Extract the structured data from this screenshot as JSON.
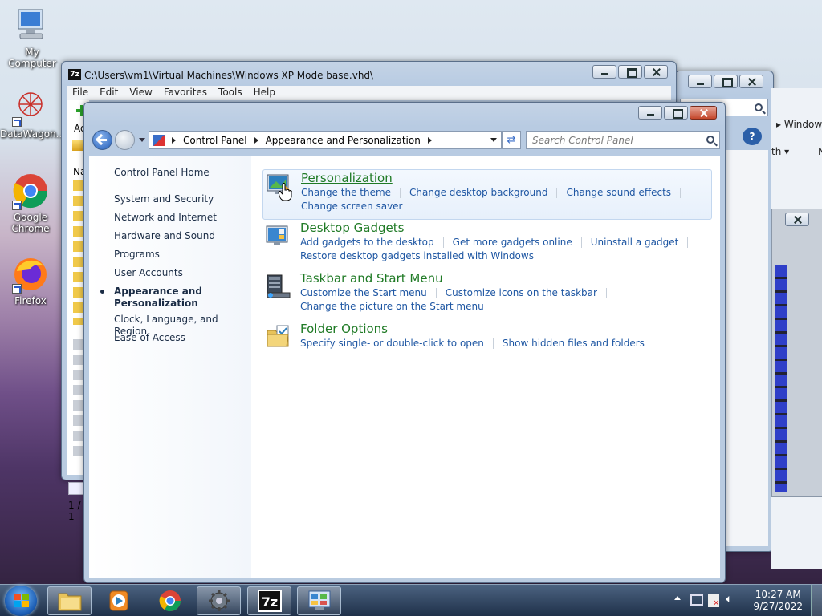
{
  "desktop": {
    "icons": [
      {
        "label": "My Computer",
        "icon": "computer-icon"
      },
      {
        "label": "DataWagon...",
        "icon": "datawagon-icon"
      },
      {
        "label": "Google Chrome",
        "icon": "chrome-icon"
      },
      {
        "label": "Firefox",
        "icon": "firefox-icon"
      }
    ]
  },
  "sevenzip": {
    "title": "C:\\Users\\vm1\\Virtual Machines\\Windows XP Mode base.vhd\\",
    "menu": [
      "File",
      "Edit",
      "View",
      "Favorites",
      "Tools",
      "Help"
    ],
    "add_label": "Ad",
    "col_label": "Na",
    "status": "1 / 1"
  },
  "explorer_back": {
    "breadcrumb": "Window",
    "menu": "th",
    "col": "N"
  },
  "control_panel": {
    "address": [
      "Control Panel",
      "Appearance and Personalization"
    ],
    "search_placeholder": "Search Control Panel",
    "left_nav": [
      {
        "label": "Control Panel Home",
        "current": false
      },
      {
        "label": "System and Security",
        "current": false
      },
      {
        "label": "Network and Internet",
        "current": false
      },
      {
        "label": "Hardware and Sound",
        "current": false
      },
      {
        "label": "Programs",
        "current": false
      },
      {
        "label": "User Accounts",
        "current": false
      },
      {
        "label": "Appearance and Personalization",
        "current": true
      },
      {
        "label": "Clock, Language, and Region",
        "current": false
      },
      {
        "label": "Ease of Access",
        "current": false
      }
    ],
    "categories": [
      {
        "title": "Personalization",
        "icon": "personalization-icon",
        "highlighted": true,
        "rows": [
          [
            "Change the theme",
            "Change desktop background",
            "Change sound effects"
          ],
          [
            "Change screen saver"
          ]
        ]
      },
      {
        "title": "Desktop Gadgets",
        "icon": "gadgets-icon",
        "highlighted": false,
        "rows": [
          [
            "Add gadgets to the desktop",
            "Get more gadgets online",
            "Uninstall a gadget"
          ],
          [
            "Restore desktop gadgets installed with Windows"
          ]
        ]
      },
      {
        "title": "Taskbar and Start Menu",
        "icon": "taskbar-icon",
        "highlighted": false,
        "rows": [
          [
            "Customize the Start menu",
            "Customize icons on the taskbar"
          ],
          [
            "Change the picture on the Start menu"
          ]
        ]
      },
      {
        "title": "Folder Options",
        "icon": "folder-options-icon",
        "highlighted": false,
        "rows": [
          [
            "Specify single- or double-click to open",
            "Show hidden files and folders"
          ]
        ]
      }
    ]
  },
  "taskbar": {
    "items": [
      "explorer",
      "media-player",
      "chrome",
      "settings",
      "7zip",
      "control-panel"
    ],
    "time": "10:27 AM",
    "date": "9/27/2022"
  },
  "colors": {
    "link": "#1f57a3",
    "heading": "#1f7a25",
    "nav_text": "#1a2c45"
  }
}
